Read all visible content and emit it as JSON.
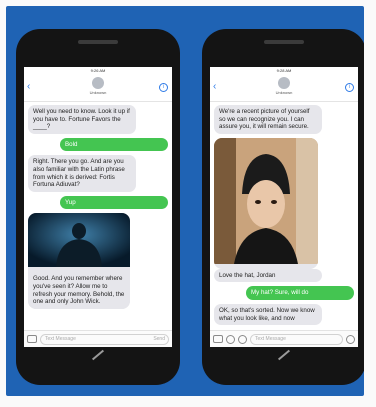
{
  "left_phone": {
    "status": "9:26 AM",
    "contact": "Unknown",
    "messages": [
      {
        "from": "in",
        "text": "Well you need to know. Look it up if you have to. Fortune Favors the ____?"
      },
      {
        "from": "out",
        "text": "Bold"
      },
      {
        "from": "in",
        "text": "Right. There you go. And are you also familiar with the Latin phrase from which it is derived: Fortis Fortuna Adiuvat?"
      },
      {
        "from": "out",
        "text": "Yup"
      },
      {
        "from": "in",
        "text": "Good. And you remember where you've seen it? Allow me to refresh your memory. Behold, the one and only John Wick."
      }
    ],
    "input_placeholder": "Text Message",
    "send_label": "Send"
  },
  "right_phone": {
    "status": "9:28 AM",
    "contact": "Unknown",
    "messages": [
      {
        "from": "in",
        "text": "We're a recent picture of yourself so we can recognize you. I can assure you, it will remain secure."
      },
      {
        "from": "in",
        "text": "Love the hat, Jordan"
      },
      {
        "from": "out",
        "text": "My hat? Sure, will do"
      },
      {
        "from": "in",
        "text": "OK, so that's sorted. Now we know what you look like, and now"
      }
    ],
    "input_placeholder": "Text Message"
  },
  "icons": {
    "back": "chevron-left-icon",
    "info": "info-icon",
    "camera": "camera-icon",
    "appstore": "app-store-icon",
    "mic": "mic-icon",
    "send": "send-icon"
  },
  "colors": {
    "panel": "#1f63b4",
    "phone": "#141414",
    "incoming": "#e6e6eb",
    "outgoing": "#44c551",
    "link": "#2f7be7"
  }
}
